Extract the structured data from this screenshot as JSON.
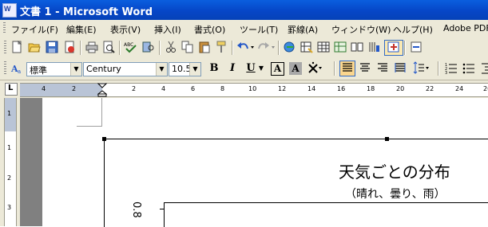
{
  "window": {
    "title": "文書 1 - Microsoft Word",
    "app_icon": "W"
  },
  "menubar": {
    "items": [
      {
        "label": "ファイル(F)"
      },
      {
        "label": "編集(E)"
      },
      {
        "label": "表示(V)"
      },
      {
        "label": "挿入(I)"
      },
      {
        "label": "書式(O)"
      },
      {
        "label": "ツール(T)"
      },
      {
        "label": "罫線(A)"
      },
      {
        "label": "ウィンドウ(W)"
      },
      {
        "label": "ヘルプ(H)"
      },
      {
        "label": "Adobe PDF"
      }
    ]
  },
  "standard_toolbar": {
    "icons": [
      "new-document-icon",
      "open-folder-icon",
      "save-icon",
      "permission-icon",
      "print-icon",
      "print-preview-icon",
      "spelling-icon",
      "research-icon",
      "cut-icon",
      "copy-icon",
      "paste-icon",
      "format-painter-icon",
      "undo-icon",
      "redo-icon",
      "hyperlink-icon",
      "tables-borders-icon",
      "insert-table-icon",
      "insert-excel-icon",
      "columns-icon",
      "drawing-icon",
      "document-map-icon",
      "show-hide-icon"
    ]
  },
  "formatting_toolbar": {
    "style_icon": "style-icon",
    "style_value": "標準",
    "font_value": "Century",
    "size_value": "10.5",
    "bold_label": "B",
    "italic_label": "I",
    "underline_label": "U",
    "char_border_label": "A",
    "char_shading_label": "A",
    "emphasis_label": "文"
  },
  "ruler": {
    "corner_label": "L",
    "h_numbers": [
      "4",
      "2",
      "2",
      "4",
      "6",
      "8",
      "10",
      "12",
      "14",
      "16",
      "18",
      "20",
      "22",
      "24",
      "26"
    ],
    "v_numbers": [
      "1",
      "1",
      "2",
      "3"
    ]
  },
  "chart": {
    "title": "天気ごとの分布",
    "subtitle": "（晴れ、曇り、雨）",
    "y_tick_label": "0.8"
  },
  "colors": {
    "titlebar": "#0a5fdf",
    "toolbar_bg": "#ece9d8",
    "document_bg": "#808080"
  }
}
